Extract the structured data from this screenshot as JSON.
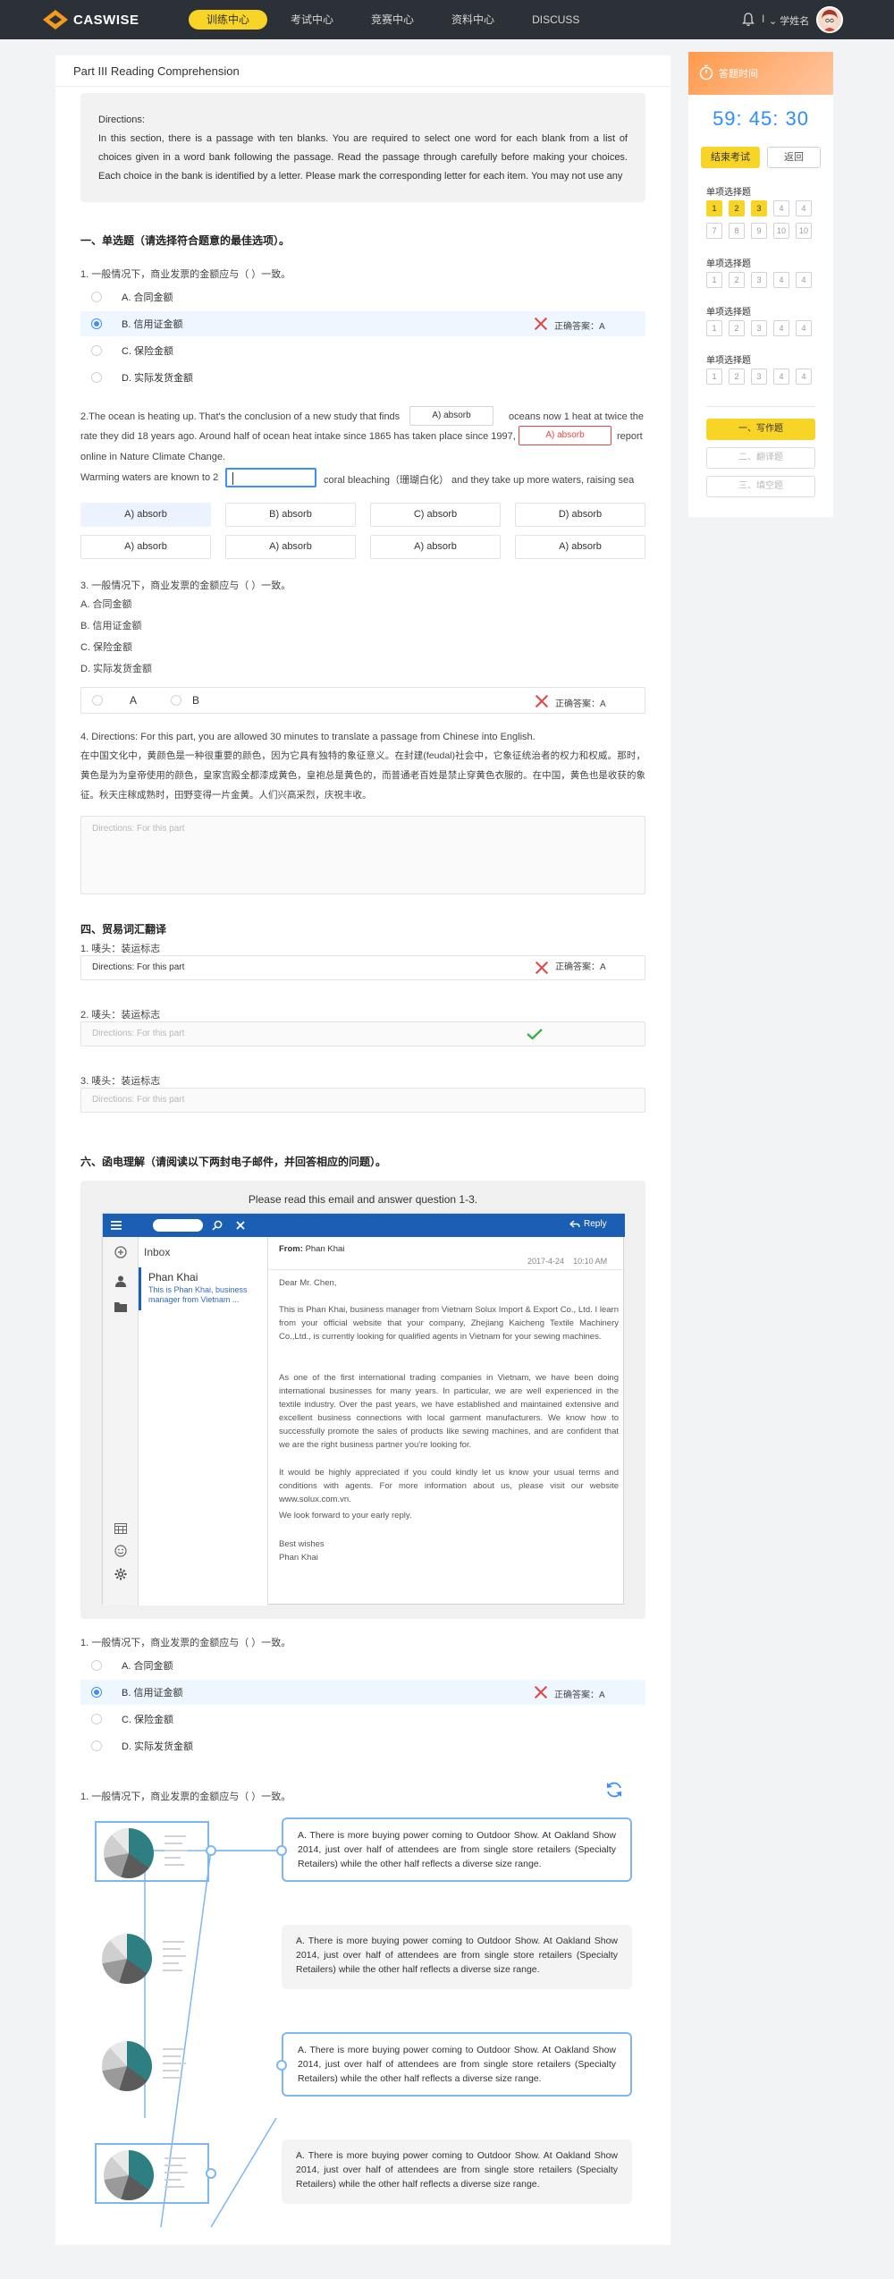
{
  "header": {
    "brand": "CASWISE",
    "nav": [
      "训练中心",
      "考试中心",
      "竞赛中心",
      "资料中心",
      "DISCUSS"
    ],
    "active_nav": 0,
    "user_sep": "I",
    "user_name": "学姓名"
  },
  "main": {
    "title": "Part III Reading Comprehension",
    "directions_label": "Directions:",
    "directions_text": "In this section, there is a passage with ten blanks. You are required to select one word for each blank from a list of choices given in a word bank following the passage. Read the passage through carefully before making your choices. Each choice in the bank is identified by a letter. Please mark the corresponding letter for each item. You may not use any",
    "section1_title": "一、单选题（请选择符合题意的最佳选项）。",
    "q1": {
      "text": "1. 一般情况下，商业发票的金额应与（  ）一致。",
      "options": [
        "A. 合同金额",
        "B. 信用证金额",
        "C. 保险金额",
        "D. 实际发货金额"
      ],
      "selected": 1,
      "answer": "正确答案：A"
    },
    "q2": {
      "line1_a": "2.The ocean is heating up. That's the conclusion of a new study that finds",
      "line1_b": "oceans now 1 heat at twice the",
      "line2_a": "rate they did 18 years ago. Around half of ocean heat intake since 1865 has taken place since 1997,",
      "line2_b": "report",
      "line3": "online in Nature Climate Change.",
      "line4_a": "Warming waters are known to 2",
      "line4_b": "coral bleaching（珊瑚白化） and they take up more waters, raising sea",
      "blank1": "A) absorb",
      "blank2": "A) absorb",
      "choices_row1": [
        "A) absorb",
        "B) absorb",
        "C) absorb",
        "D) absorb"
      ],
      "choices_row2": [
        "A) absorb",
        "A) absorb",
        "A) absorb",
        "A) absorb"
      ]
    },
    "q3": {
      "text": "3. 一般情况下，商业发票的金额应与（  ）一致。",
      "options": [
        "A. 合同金额",
        "B. 信用证金额",
        "C. 保险金额",
        "D. 实际发货金额"
      ],
      "ab": [
        "A",
        "B"
      ],
      "answer": "正确答案：A"
    },
    "q4": {
      "text": "4. Directions: For this part, you are allowed 30 minutes to translate a passage from Chinese into English.",
      "passage": "在中国文化中，黄颜色是一种很重要的颜色，因为它具有独特的象征意义。在封建(feudal)社会中，它象征统治者的权力和权威。那时，黄色是为为皇帝使用的颜色，皇家宫殿全都漆成黄色，皇袍总是黄色的，而普通老百姓是禁止穿黄色衣服的。在中国，黄色也是收获的象征。秋天庄稼成熟时，田野变得一片金黄。人们兴高采烈，庆祝丰收。",
      "placeholder": "Directions: For this part"
    },
    "section4_title": "四、贸易词汇翻译",
    "vocab": [
      {
        "q": "1. 唛头：装运标志",
        "value": "Directions: For this part",
        "answer": "正确答案：A",
        "result": "wrong"
      },
      {
        "q": "2. 唛头：装运标志",
        "value": "Directions: For this part",
        "result": "correct"
      },
      {
        "q": "3. 唛头：装运标志",
        "value": "Directions: For this part",
        "result": "none"
      }
    ],
    "section6_title": "六、函电理解（请阅读以下两封电子邮件，并回答相应的问题）。",
    "email": {
      "caption": "Please read this email and answer question 1-3.",
      "reply": "Reply",
      "inbox": "Inbox",
      "list_name": "Phan Khai",
      "list_preview": "This is Phan Khai, business manager from Vietnam ...",
      "from_label": "From:",
      "from_name": "Phan Khai",
      "date": "2017-4-24",
      "time": "10:10 AM",
      "greeting": "Dear Mr. Chen,",
      "p1": "This is Phan Khai, business manager from Vietnam Solux Import & Export Co., Ltd. I learn from your official website that your company, Zhejiang Kaicheng Textile Machinery Co.,Ltd., is currently looking for qualified agents in Vietnam for your sewing machines.",
      "p2": "As one of the first international trading companies in Vietnam, we have been doing international businesses for many years. In particular, we are well experienced in the textile industry. Over the past years, we have established and maintained extensive and excellent business connections with local garment manufacturers. We know how to successfully promote the sales of products like sewing machines, and are confident that we are the right business partner you're looking for.",
      "p3": "It would be highly appreciated if you could kindly let us know your usual terms and conditions with agents. For more information about us, please visit our website www.solux.com.vn.",
      "p4": "We look forward to your early reply.",
      "closing": "Best wishes",
      "signature": "Phan Khai"
    },
    "q6": {
      "text": "1. 一般情况下，商业发票的金额应与（  ）一致。",
      "options": [
        "A. 合同金额",
        "B. 信用证金额",
        "C. 保险金额",
        "D. 实际发货金额"
      ],
      "selected": 1,
      "answer": "正确答案：A"
    },
    "q7": {
      "text": "1. 一般情况下，商业发票的金额应与（  ）一致。",
      "cards": [
        "A. There is more buying power coming to Outdoor Show. At Oakland Show 2014, just over half of attendees are from single store retailers (Specialty Retailers) while the other half reflects a diverse size range.",
        "A. There is more buying power coming to Outdoor Show. At Oakland Show 2014, just over half of attendees are from single store retailers (Specialty Retailers) while the other half reflects a diverse size range.",
        "A. There is more buying power coming to Outdoor Show. At Oakland Show 2014, just over half of attendees are from single store retailers (Specialty Retailers) while the other half reflects a diverse size range.",
        "A. There is more buying power coming to Outdoor Show. At Oakland Show 2014, just over half of attendees are from single store retailers (Specialty Retailers) while the other half reflects a diverse size range."
      ]
    }
  },
  "side": {
    "title": "答题时间",
    "timer": "59: 45: 30",
    "end_btn": "结束考试",
    "back_btn": "返回",
    "groups": [
      {
        "title": "单项选择题",
        "nums": [
          "1",
          "2",
          "3",
          "4",
          "4",
          "7",
          "8",
          "9",
          "10",
          "10"
        ],
        "done": [
          0,
          1,
          2
        ]
      },
      {
        "title": "单项选择题",
        "nums": [
          "1",
          "2",
          "3",
          "4",
          "4"
        ],
        "done": []
      },
      {
        "title": "单项选择题",
        "nums": [
          "1",
          "2",
          "3",
          "4",
          "4"
        ],
        "done": []
      },
      {
        "title": "单项选择题",
        "nums": [
          "1",
          "2",
          "3",
          "4",
          "4"
        ],
        "done": []
      }
    ],
    "buttons": [
      "一、写作题",
      "二、翻译题",
      "三、填空题"
    ]
  },
  "colors": {
    "accent_yellow": "#f8d427",
    "accent_blue": "#2f8cff",
    "error_red": "#e54545",
    "success_green": "#3fae49",
    "header_bg": "#2c3037"
  }
}
